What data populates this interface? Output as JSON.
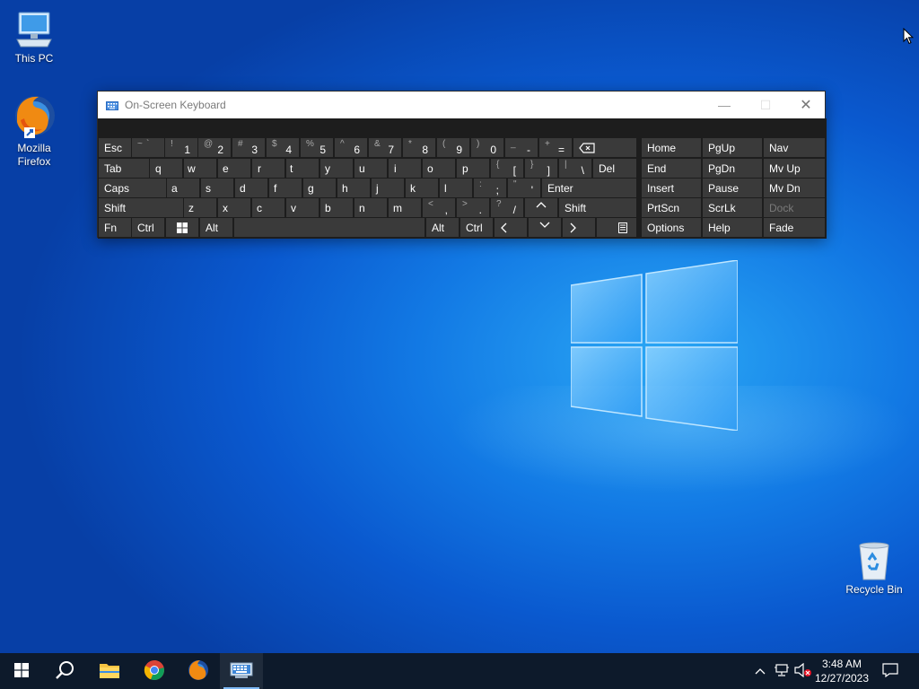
{
  "desktop": {
    "icons": [
      {
        "label": "This PC",
        "icon": "computer-icon"
      },
      {
        "label": "Mozilla Firefox",
        "icon": "firefox-icon"
      },
      {
        "label": "Recycle Bin",
        "icon": "recycle-bin-icon"
      }
    ]
  },
  "osk": {
    "title": "On-Screen Keyboard",
    "keys": {
      "esc": "Esc",
      "tilde_top": "~",
      "tilde_bot": "`",
      "n1_top": "!",
      "n1": "1",
      "n2_top": "@",
      "n2": "2",
      "n3_top": "#",
      "n3": "3",
      "n4_top": "$",
      "n4": "4",
      "n5_top": "%",
      "n5": "5",
      "n6_top": "^",
      "n6": "6",
      "n7_top": "&",
      "n7": "7",
      "n8_top": "*",
      "n8": "8",
      "n9_top": "(",
      "n9": "9",
      "n0_top": ")",
      "n0": "0",
      "minus_top": "_",
      "minus": "-",
      "equal_top": "+",
      "equal": "=",
      "tab": "Tab",
      "q": "q",
      "w": "w",
      "e": "e",
      "r": "r",
      "t": "t",
      "y": "y",
      "u": "u",
      "i": "i",
      "o": "o",
      "p": "p",
      "lbracket_top": "{",
      "lbracket": "[",
      "rbracket_top": "}",
      "rbracket": "]",
      "backslash_top": "|",
      "backslash": "\\",
      "del": "Del",
      "caps": "Caps",
      "a": "a",
      "s": "s",
      "d": "d",
      "f": "f",
      "g": "g",
      "h": "h",
      "j": "j",
      "k": "k",
      "l": "l",
      "semicolon_top": ":",
      "semicolon": ";",
      "quote_top": "\"",
      "quote": "'",
      "enter": "Enter",
      "shift": "Shift",
      "z": "z",
      "x": "x",
      "c": "c",
      "v": "v",
      "b": "b",
      "n": "n",
      "m": "m",
      "comma_top": "<",
      "comma": ",",
      "period_top": ">",
      "period": ".",
      "slash_top": "?",
      "slash": "/",
      "shift_r": "Shift",
      "fn": "Fn",
      "ctrl": "Ctrl",
      "alt": "Alt",
      "alt_r": "Alt",
      "ctrl_r": "Ctrl",
      "home": "Home",
      "pgup": "PgUp",
      "nav": "Nav",
      "end": "End",
      "pgdn": "PgDn",
      "mvup": "Mv Up",
      "insert": "Insert",
      "pause": "Pause",
      "mvdn": "Mv Dn",
      "prtscn": "PrtScn",
      "scrlk": "ScrLk",
      "dock": "Dock",
      "options": "Options",
      "help": "Help",
      "fade": "Fade"
    }
  },
  "taskbar": {
    "time": "3:48 AM",
    "date": "12/27/2023",
    "apps": [
      "start",
      "search",
      "file-explorer",
      "chrome",
      "firefox",
      "on-screen-keyboard"
    ]
  },
  "colors": {
    "key_bg": "#3a3a3a",
    "osk_bg": "#1d1d1d",
    "taskbar_bg": "#0d1a2b"
  }
}
